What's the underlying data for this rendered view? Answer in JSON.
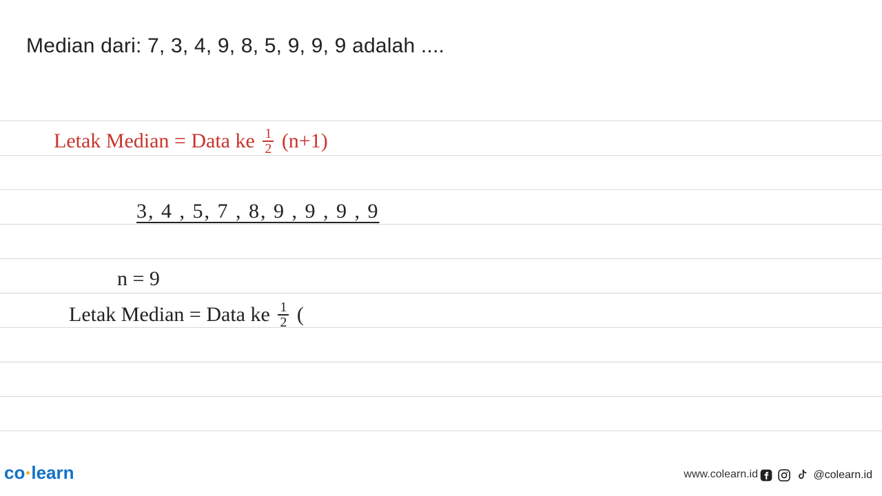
{
  "question": "Median dari: 7, 3, 4, 9, 8, 5, 9, 9, 9 adalah ....",
  "work": {
    "line1_lhs": "Letak  Median  = ",
    "line1_rhs_a": "Data ke ",
    "line1_rhs_b": " (n+1)",
    "sorted": "3, 4 , 5,  7 ,  8,  9 , 9 , 9 , 9",
    "n_eq": "n = 9",
    "line2_lhs": "Letak  Median = ",
    "line2_rhs_a": "Data  ke  ",
    "line2_rhs_b": " (",
    "half_num": "1",
    "half_den": "2"
  },
  "footer": {
    "logo_left": "co",
    "logo_right": "learn",
    "url": "www.colearn.id",
    "handle": "@colearn.id"
  }
}
